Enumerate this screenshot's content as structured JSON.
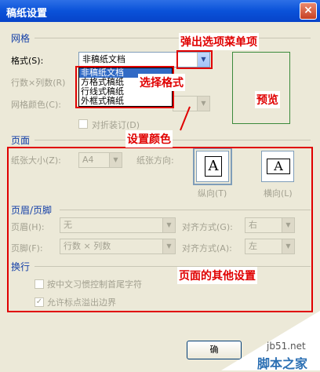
{
  "window": {
    "title": "稿纸设置",
    "close_label": "×"
  },
  "grid": {
    "section": "网格",
    "format_label": "格式(S):",
    "format_value": "非稿纸文档",
    "format_options": [
      "非稿纸文档",
      "方格式稿纸",
      "行线式稿纸",
      "外框式稿纸"
    ],
    "rows_cols_label": "行数×列数(R)",
    "color_label": "网格颜色(C):",
    "fold_label": "对折装订(D)",
    "preview_label": "预览"
  },
  "page": {
    "section": "页面",
    "size_label": "纸张大小(Z):",
    "size_value": "A4",
    "orientation_label": "纸张方向:",
    "portrait_label": "纵向(T)",
    "landscape_label": "横向(L)",
    "paper_glyph": "A"
  },
  "header_footer": {
    "section": "页眉/页脚",
    "header_label": "页眉(H):",
    "header_value": "无",
    "header_align_label": "对齐方式(G):",
    "header_align_value": "右",
    "footer_label": "页脚(F):",
    "footer_value": "行数 × 列数",
    "footer_align_label": "对齐方式(A):",
    "footer_align_value": "左"
  },
  "wrap": {
    "section": "换行",
    "option1": "按中文习惯控制首尾字符",
    "option2": "允许标点溢出边界"
  },
  "buttons": {
    "ok": "确"
  },
  "annotations": {
    "popup": "弹出选项菜单项",
    "select_format": "选择格式",
    "preview": "预览",
    "set_color": "设置颜色",
    "other_settings": "页面的其他设置"
  },
  "watermark": {
    "site": "jb51.net",
    "brand": "脚本之家"
  },
  "colors": {
    "annotation": "#e00000",
    "selection": "#316ac5",
    "section_title": "#1540a8"
  }
}
